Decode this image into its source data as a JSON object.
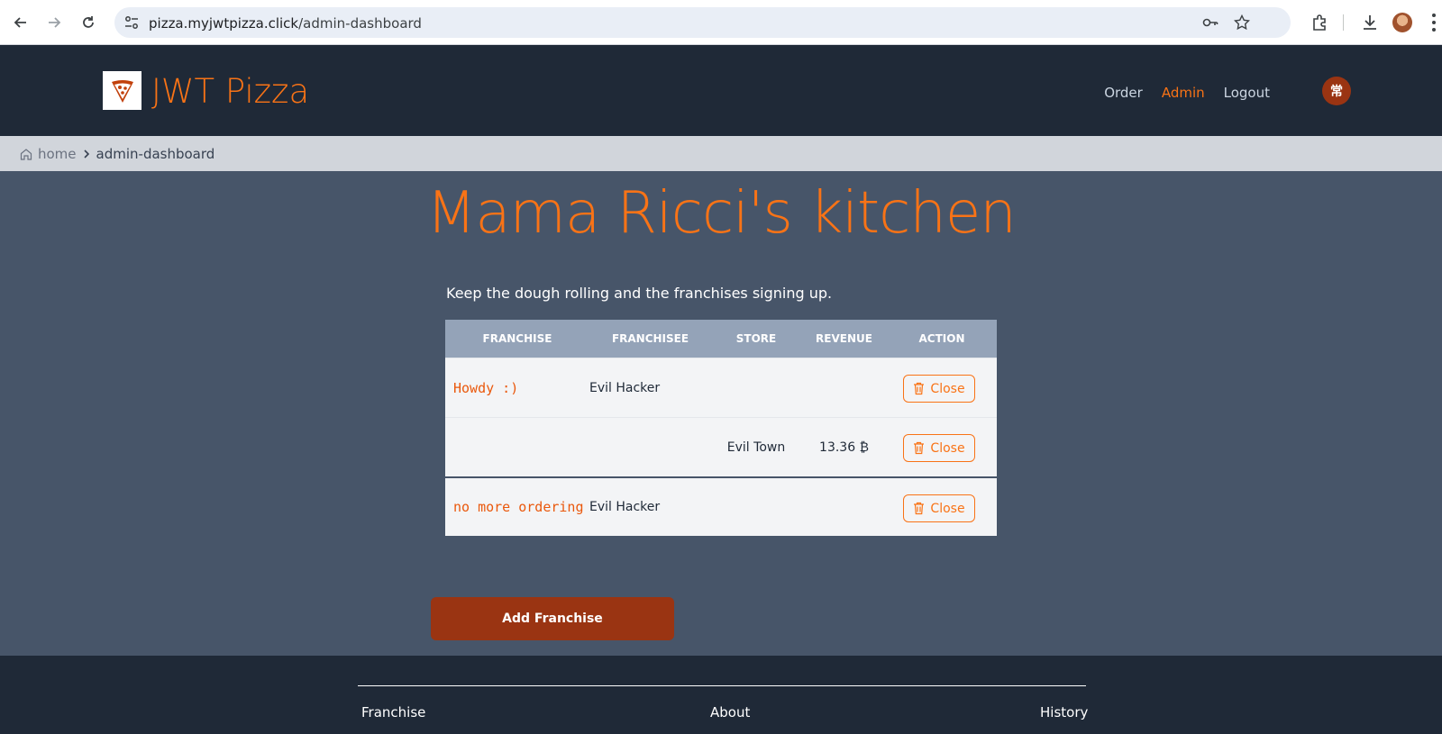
{
  "browser": {
    "url_host": "pizza.myjwtpizza.click",
    "url_path": "/admin-dashboard"
  },
  "header": {
    "brand": "JWT Pizza",
    "nav": {
      "order": "Order",
      "admin": "Admin",
      "logout": "Logout"
    },
    "avatar_text": "常"
  },
  "breadcrumb": {
    "home": "home",
    "current": "admin-dashboard"
  },
  "main": {
    "title": "Mama Ricci's kitchen",
    "subtitle": "Keep the dough rolling and the franchises signing up."
  },
  "table": {
    "headers": [
      "FRANCHISE",
      "FRANCHISEE",
      "STORE",
      "REVENUE",
      "ACTION"
    ],
    "rows": [
      {
        "franchise": "Howdy :)",
        "franchisee": "Evil Hacker",
        "store": "",
        "revenue": "",
        "action": "Close"
      },
      {
        "franchise": "",
        "franchisee": "",
        "store": "Evil Town",
        "revenue": "13.36 ₿",
        "action": "Close"
      },
      {
        "franchise": "no more ordering",
        "franchisee": "Evil Hacker",
        "store": "",
        "revenue": "",
        "action": "Close"
      }
    ]
  },
  "add_franchise_label": "Add Franchise",
  "footer": {
    "franchise": "Franchise",
    "about": "About",
    "history": "History"
  },
  "colors": {
    "accent": "#f97316",
    "header_bg": "#1f2937",
    "page_bg": "#475569",
    "button_bg": "#9a3412"
  }
}
